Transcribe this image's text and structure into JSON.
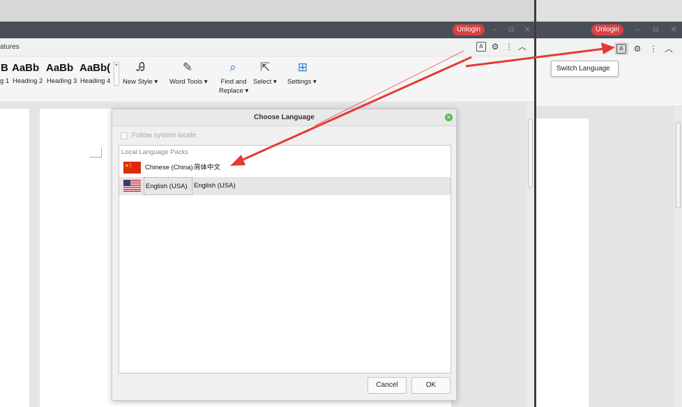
{
  "app": {
    "unlogin_label": "Unlogin",
    "tab_fragment": "atures",
    "window_controls": {
      "minimize": "–",
      "restore": "⧉",
      "close": "✕"
    }
  },
  "toolbar_icons": {
    "switch_language": "switch-language-icon",
    "settings": "gear-icon",
    "more": "more-vertical-icon",
    "collapse": "chevron-up-icon"
  },
  "styles_gallery": [
    {
      "preview": "B",
      "name": "g 1"
    },
    {
      "preview": "AaBb",
      "name": "Heading 2"
    },
    {
      "preview": "AaBb",
      "name": "Heading 3"
    },
    {
      "preview": "AaBb(",
      "name": "Heading 4"
    }
  ],
  "ribbon": {
    "new_style": "New Style",
    "word_tools": "Word Tools",
    "find_replace_line1": "Find and",
    "find_replace_line2": "Replace",
    "select": "Select",
    "settings": "Settings"
  },
  "tooltip": {
    "text": "Switch Language"
  },
  "dialog": {
    "title": "Choose Language",
    "follow_locale": "Follow system locale",
    "follow_locale_checked": false,
    "list_header": "Local Language Packs",
    "languages": [
      {
        "flag": "china-flag-icon",
        "name": "Chinese (China)",
        "native": "简体中文",
        "selected": false
      },
      {
        "flag": "usa-flag-icon",
        "name": "English (USA)",
        "native": "English (USA)",
        "selected": true
      }
    ],
    "cancel_label": "Cancel",
    "ok_label": "OK"
  },
  "colors": {
    "unlogin_badge": "#d94242",
    "annotation_arrow": "#e53935",
    "titlebar": "#4a4f55",
    "accent_icon": "#2b7bd3"
  }
}
